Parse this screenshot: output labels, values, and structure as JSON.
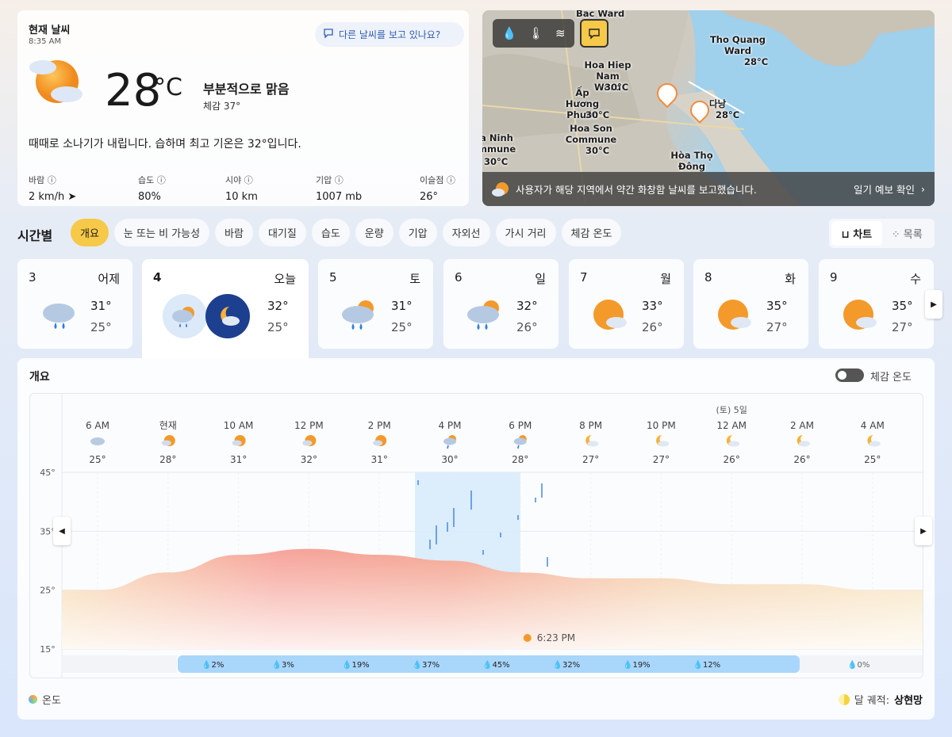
{
  "current": {
    "title": "현재 날씨",
    "time": "8:35 AM",
    "ask_label": "다른 날씨를 보고 있나요?",
    "temp": "28",
    "unit": "°C",
    "condition": "부분적으로 맑음",
    "feels_like": "체감   37°",
    "summary": "때때로 소나기가 내립니다. 습하며 최고 기온은 32°입니다.",
    "stats": [
      {
        "label": "바람 ⓘ",
        "value": "2 km/h ➤"
      },
      {
        "label": "습도 ⓘ",
        "value": "80%"
      },
      {
        "label": "시야 ⓘ",
        "value": "10 km"
      },
      {
        "label": "기압 ⓘ",
        "value": "1007 mb"
      },
      {
        "label": "이슬점 ⓘ",
        "value": "26°"
      }
    ]
  },
  "map": {
    "labels": [
      "Bac Ward",
      "Tho Quang Ward",
      "28°C",
      "Hoa Hiep Nam Ward",
      "30°C",
      "Ấp Hương Phước",
      "30°C",
      "다낭",
      "28°C",
      "Hoa Son Commune",
      "30°C",
      "a Ninh mmune",
      "30°C",
      "Hòa Thọ Đông"
    ],
    "bar_text": "사용자가 해당 지역에서 약간 화창함 날씨를 보고했습니다.",
    "bar_link": "일기 예보 확인"
  },
  "hourly": {
    "title": "시간별",
    "pills": [
      "개요",
      "눈 또는 비 가능성",
      "바람",
      "대기질",
      "습도",
      "운량",
      "기압",
      "자외선",
      "가시 거리",
      "체감 온도"
    ],
    "view_chart": "⊔ 차트",
    "view_list": "⁘ 목록"
  },
  "days": [
    {
      "num": "3",
      "wd": "어제",
      "hi": "31°",
      "lo": "25°",
      "icon": "rain"
    },
    {
      "num": "4",
      "wd": "오늘",
      "hi": "32°",
      "lo": "25°",
      "icon": "today"
    },
    {
      "num": "5",
      "wd": "토",
      "hi": "31°",
      "lo": "25°",
      "icon": "rain-sun"
    },
    {
      "num": "6",
      "wd": "일",
      "hi": "32°",
      "lo": "26°",
      "icon": "rain-sun"
    },
    {
      "num": "7",
      "wd": "월",
      "hi": "33°",
      "lo": "26°",
      "icon": "sun-cloud"
    },
    {
      "num": "8",
      "wd": "화",
      "hi": "35°",
      "lo": "27°",
      "icon": "sun-cloud"
    },
    {
      "num": "9",
      "wd": "수",
      "hi": "35°",
      "lo": "27°",
      "icon": "sun-cloud"
    }
  ],
  "overview": {
    "title": "개요",
    "toggle_label": "체감 온도",
    "legend": "온도",
    "moon_label": "달 궤적:",
    "moon_value": "상현망",
    "sunset": "6:23 PM",
    "date_marker": "(토) 5일"
  },
  "chart_data": {
    "type": "area",
    "x": [
      "6 AM",
      "현재",
      "10 AM",
      "12 PM",
      "2 PM",
      "4 PM",
      "6 PM",
      "8 PM",
      "10 PM",
      "12 AM",
      "2 AM",
      "4 AM"
    ],
    "temps": [
      25,
      28,
      31,
      32,
      31,
      30,
      28,
      27,
      27,
      26,
      26,
      25
    ],
    "temp_labels": [
      "25°",
      "28°",
      "31°",
      "32°",
      "31°",
      "30°",
      "28°",
      "27°",
      "27°",
      "26°",
      "26°",
      "25°"
    ],
    "y_ticks": [
      "45°",
      "35°",
      "25°",
      "15°"
    ],
    "ylim": [
      15,
      45
    ],
    "precip": [
      "2%",
      "3%",
      "19%",
      "37%",
      "45%",
      "32%",
      "19%",
      "12%"
    ],
    "precip_tail": "0%",
    "rain_period": [
      "4 PM",
      "6 PM"
    ]
  }
}
